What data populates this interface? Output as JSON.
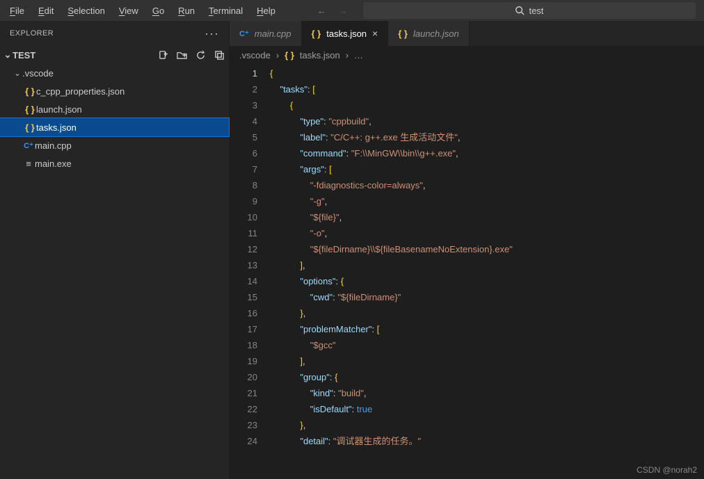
{
  "menu": {
    "items": [
      {
        "label": "File",
        "mn": "F"
      },
      {
        "label": "Edit",
        "mn": "E"
      },
      {
        "label": "Selection",
        "mn": "S"
      },
      {
        "label": "View",
        "mn": "V"
      },
      {
        "label": "Go",
        "mn": "G"
      },
      {
        "label": "Run",
        "mn": "R"
      },
      {
        "label": "Terminal",
        "mn": "T"
      },
      {
        "label": "Help",
        "mn": "H"
      }
    ]
  },
  "search_value": "test",
  "sidebar": {
    "title": "EXPLORER",
    "section": "TEST",
    "vscode_folder": ".vscode",
    "files": {
      "cpp_props": "c_cpp_properties.json",
      "launch": "launch.json",
      "tasks": "tasks.json",
      "maincpp": "main.cpp",
      "mainexe": "main.exe"
    }
  },
  "tabs": [
    {
      "icon": "cpp",
      "label": "main.cpp",
      "active": false,
      "closeable": false
    },
    {
      "icon": "json",
      "label": "tasks.json",
      "active": true,
      "closeable": true
    },
    {
      "icon": "json",
      "label": "launch.json",
      "active": false,
      "closeable": false
    }
  ],
  "breadcrumbs": {
    "folder": ".vscode",
    "file": "tasks.json"
  },
  "code": {
    "lines": [
      "{",
      "    \"tasks\": [",
      "        {",
      "            \"type\": \"cppbuild\",",
      "            \"label\": \"C/C++: g++.exe 生成活动文件\",",
      "            \"command\": \"F:\\\\MinGW\\\\bin\\\\g++.exe\",",
      "            \"args\": [",
      "                \"-fdiagnostics-color=always\",",
      "                \"-g\",",
      "                \"${file}\",",
      "                \"-o\",",
      "                \"${fileDirname}\\\\${fileBasenameNoExtension}.exe\"",
      "            ],",
      "            \"options\": {",
      "                \"cwd\": \"${fileDirname}\"",
      "            },",
      "            \"problemMatcher\": [",
      "                \"$gcc\"",
      "            ],",
      "            \"group\": {",
      "                \"kind\": \"build\",",
      "                \"isDefault\": true",
      "            },",
      "            \"detail\": \"调试器生成的任务。\""
    ],
    "current_line": 1
  },
  "watermark": "CSDN @norah2"
}
